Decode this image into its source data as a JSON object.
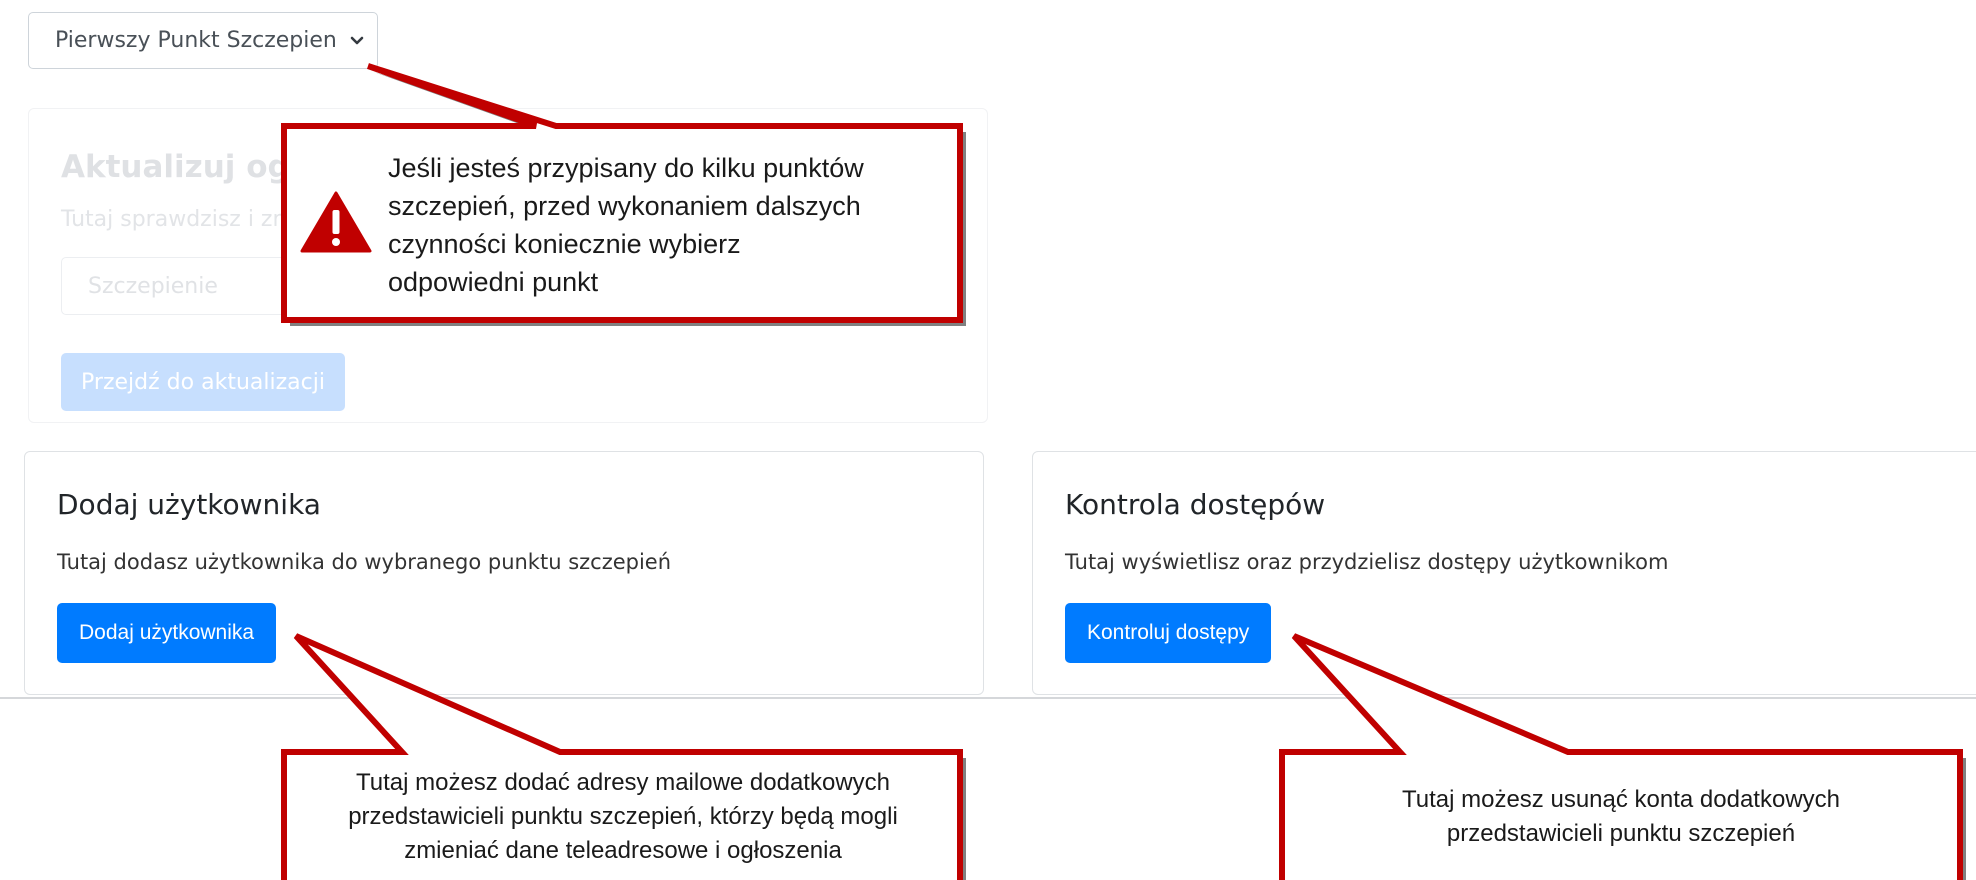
{
  "point_select": {
    "selected": "Pierwszy Punkt Szczepien"
  },
  "announcements_card": {
    "title": "Aktualizuj ogłos",
    "description": "Tutaj sprawdzisz i zm",
    "input_value": "Szczepienie",
    "button_label": "Przejdź do aktualizacji"
  },
  "add_user_card": {
    "title": "Dodaj użytkownika",
    "description": "Tutaj dodasz użytkownika do wybranego punktu szczepień",
    "button_label": "Dodaj użytkownika"
  },
  "access_card": {
    "title": "Kontrola dostępów",
    "description": "Tutaj wyświetlisz oraz przydzielisz dostępy użytkownikom",
    "button_label": "Kontroluj dostępy"
  },
  "callouts": {
    "top": {
      "line1": "Jeśli jesteś przypisany do kilku punktów",
      "line2": "szczepień, przed wykonaniem dalszych",
      "line3": "czynności koniecznie wybierz",
      "line4": "odpowiedni punkt"
    },
    "bottom_left": {
      "line1": "Tutaj możesz dodać adresy mailowe dodatkowych",
      "line2": "przedstawicieli punktu szczepień, którzy będą mogli",
      "line3": "zmieniać dane teleadresowe i ogłoszenia"
    },
    "bottom_right": {
      "line1": "Tutaj możesz usunąć konta dodatkowych",
      "line2": "przedstawicieli punktu szczepień"
    }
  },
  "icons": {
    "select_chevron": "chevron-down-icon",
    "callout_warning": "warning-icon"
  },
  "colors": {
    "primary": "#007bff",
    "callout_border": "#c00000",
    "callout_shadow": "#7f7f7f",
    "warning": "#c00000"
  }
}
